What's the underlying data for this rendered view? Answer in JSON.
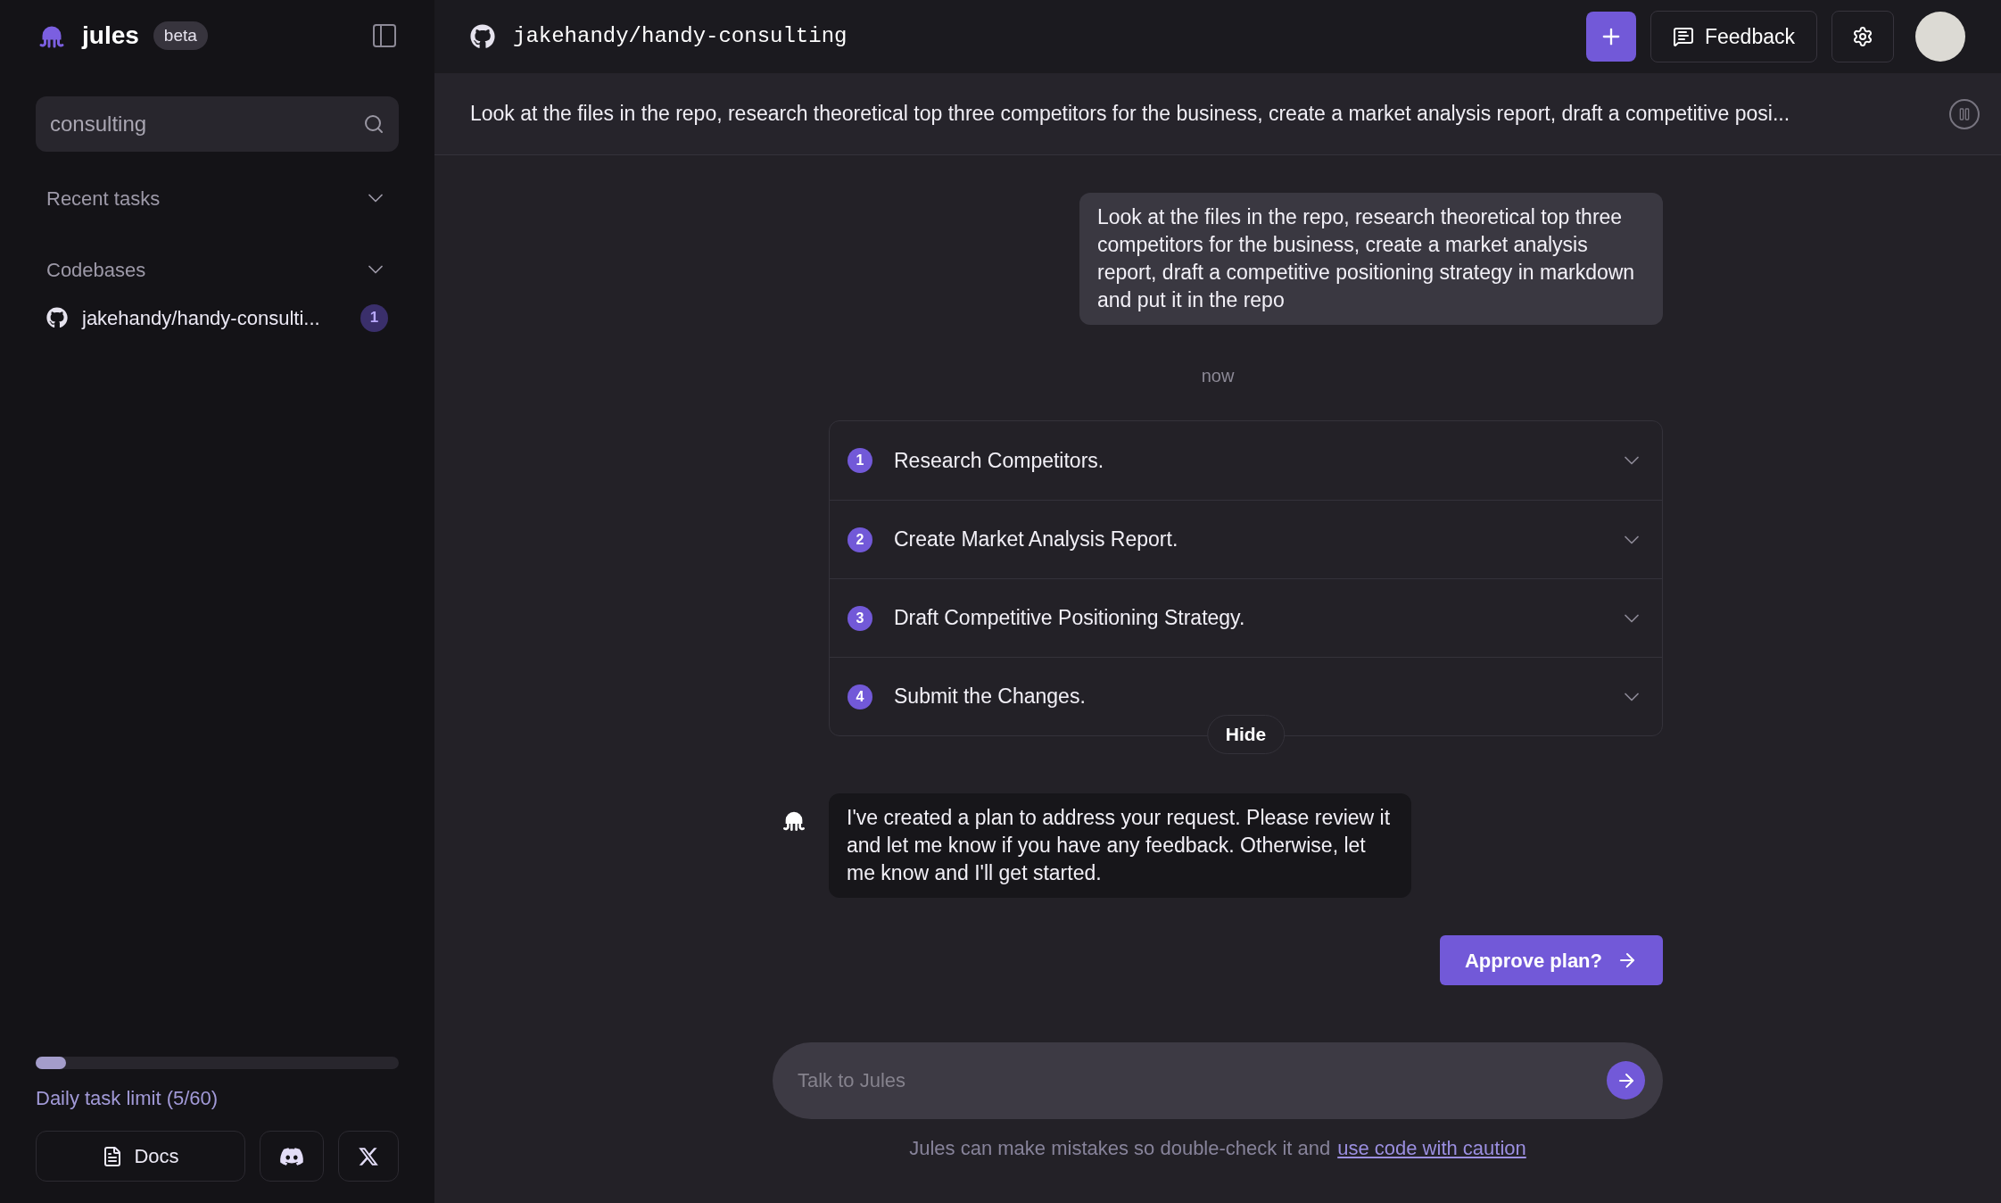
{
  "sidebar": {
    "brand": "jules",
    "badge": "beta",
    "search": {
      "value": "consulting"
    },
    "sections": [
      {
        "label": "Recent tasks"
      },
      {
        "label": "Codebases",
        "items": [
          {
            "name": "jakehandy/handy-consulti...",
            "count": "1"
          }
        ]
      }
    ],
    "usage": {
      "level": 0.083,
      "label": "Daily task limit (5/60)"
    },
    "footer_buttons": [
      {
        "kind": "docs",
        "label": "Docs"
      },
      {
        "kind": "discord"
      },
      {
        "kind": "x"
      }
    ]
  },
  "topbar": {
    "repo": "jakehandy/handy-consulting",
    "feedback": "Feedback"
  },
  "task_bar": {
    "prompt": "Look at the files in the repo, research theoretical top three competitors for the business, create a market analysis report, draft a competitive posi..."
  },
  "chat": {
    "user_message": "Look at the files in the repo, research theoretical top three competitors for the business, create a market analysis report, draft a competitive positioning strategy in markdown and put it in the repo",
    "timestamp": "now",
    "plan": {
      "steps": [
        {
          "number": "1",
          "title": "Research Competitors."
        },
        {
          "number": "2",
          "title": "Create Market Analysis Report."
        },
        {
          "number": "3",
          "title": "Draft Competitive Positioning Strategy."
        },
        {
          "number": "4",
          "title": "Submit the Changes."
        }
      ],
      "hide": "Hide"
    },
    "agent_message": "I've created a plan to address your request. Please review it and let me know if you have any feedback. Otherwise, let me know and I'll get started.",
    "approve": "Approve plan?",
    "input": {
      "placeholder": "Talk to Jules"
    },
    "disclaimer": {
      "text": "Jules can make mistakes so double-check it and",
      "link": "use code with caution"
    }
  }
}
